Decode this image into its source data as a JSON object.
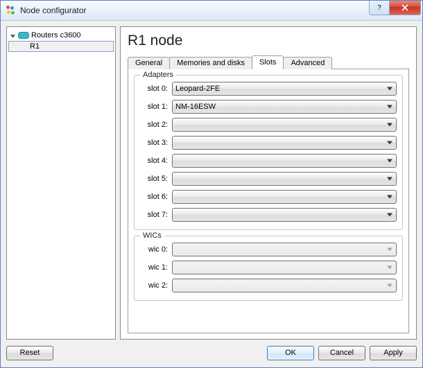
{
  "window": {
    "title": "Node configurator"
  },
  "tree": {
    "root": {
      "label": "Routers c3600"
    },
    "child": {
      "label": "R1"
    }
  },
  "heading": "R1 node",
  "tabs": {
    "general": "General",
    "memories": "Memories and disks",
    "slots": "Slots",
    "advanced": "Advanced",
    "active": "slots"
  },
  "groups": {
    "adapters": {
      "title": "Adapters",
      "slots": [
        {
          "label": "slot 0:",
          "value": "Leopard-2FE",
          "enabled": true
        },
        {
          "label": "slot 1:",
          "value": "NM-16ESW",
          "enabled": true
        },
        {
          "label": "slot 2:",
          "value": "",
          "enabled": true
        },
        {
          "label": "slot 3:",
          "value": "",
          "enabled": true
        },
        {
          "label": "slot 4:",
          "value": "",
          "enabled": true
        },
        {
          "label": "slot 5:",
          "value": "",
          "enabled": true
        },
        {
          "label": "slot 6:",
          "value": "",
          "enabled": true
        },
        {
          "label": "slot 7:",
          "value": "",
          "enabled": true
        }
      ]
    },
    "wics": {
      "title": "WICs",
      "slots": [
        {
          "label": "wic 0:",
          "value": "",
          "enabled": false
        },
        {
          "label": "wic 1:",
          "value": "",
          "enabled": false
        },
        {
          "label": "wic 2:",
          "value": "",
          "enabled": false
        }
      ]
    }
  },
  "buttons": {
    "reset": "Reset",
    "ok": "OK",
    "cancel": "Cancel",
    "apply": "Apply",
    "help": "?"
  }
}
